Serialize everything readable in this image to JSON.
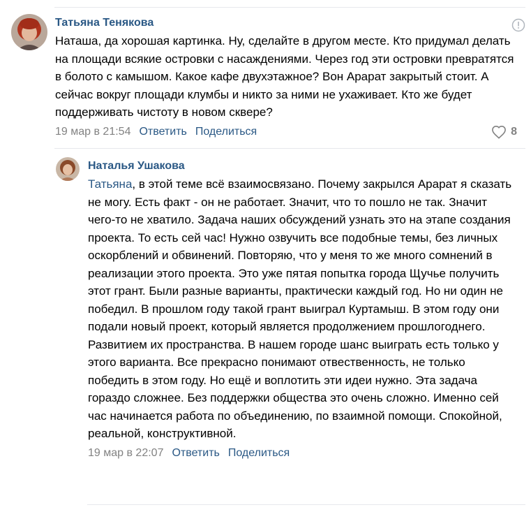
{
  "comments": [
    {
      "author": "Татьяна Тенякова",
      "text": "Наташа, да хорошая картинка. Ну, сделайте в другом месте. Кто придумал делать на площади всякие островки с насаждениями. Через год эти островки превратятся в болото с камышом. Какое кафе двухэтажное? Вон Арарат закрытый стоит. А сейчас вокруг площади клумбы и никто за ними не ухаживает. Кто же будет поддерживать чистоту в новом сквере?",
      "date": "19 мар в 21:54",
      "reply_label": "Ответить",
      "share_label": "Поделиться",
      "likes": "8",
      "report_icon": "info-circle-icon"
    },
    {
      "author": "Наталья Ушакова",
      "reply_to": "Татьяна",
      "text": ", в этой теме всё взаимосвязано. Почему закрылся Арарат я сказать не могу. Есть факт - он не работает. Значит, что то пошло не так. Значит чего-то не хватило. Задача наших обсуждений узнать это на этапе создания проекта. То есть сей час! Нужно озвучить все подобные темы, без личных оскорблений и обвинений. Повторяю, что у меня то же много сомнений в реализации этого проекта. Это уже пятая попытка города Щучье получить этот грант. Были разные варианты, практически каждый год. Но ни один не победил. В прошлом году такой грант выиграл Куртамыш. В этом году они подали новый проект, который является продолжением прошлогоднего. Развитием их пространства. В нашем городе шанс выиграть есть только у этого варианта. Все прекрасно понимают отвественность, не только победить в этом году. Но ещё и воплотить эти идеи нужно. Эта задача гораздо сложнее. Без поддержки общества это очень сложно. Именно сей час начинается работа по объединению, по взаимной помощи. Спокойной, реальной, конструктивной.",
      "date": "19 мар в 22:07",
      "reply_label": "Ответить",
      "share_label": "Поделиться"
    }
  ],
  "colors": {
    "link": "#2a5885",
    "meta": "#828282",
    "divider": "#e7e8ec"
  }
}
